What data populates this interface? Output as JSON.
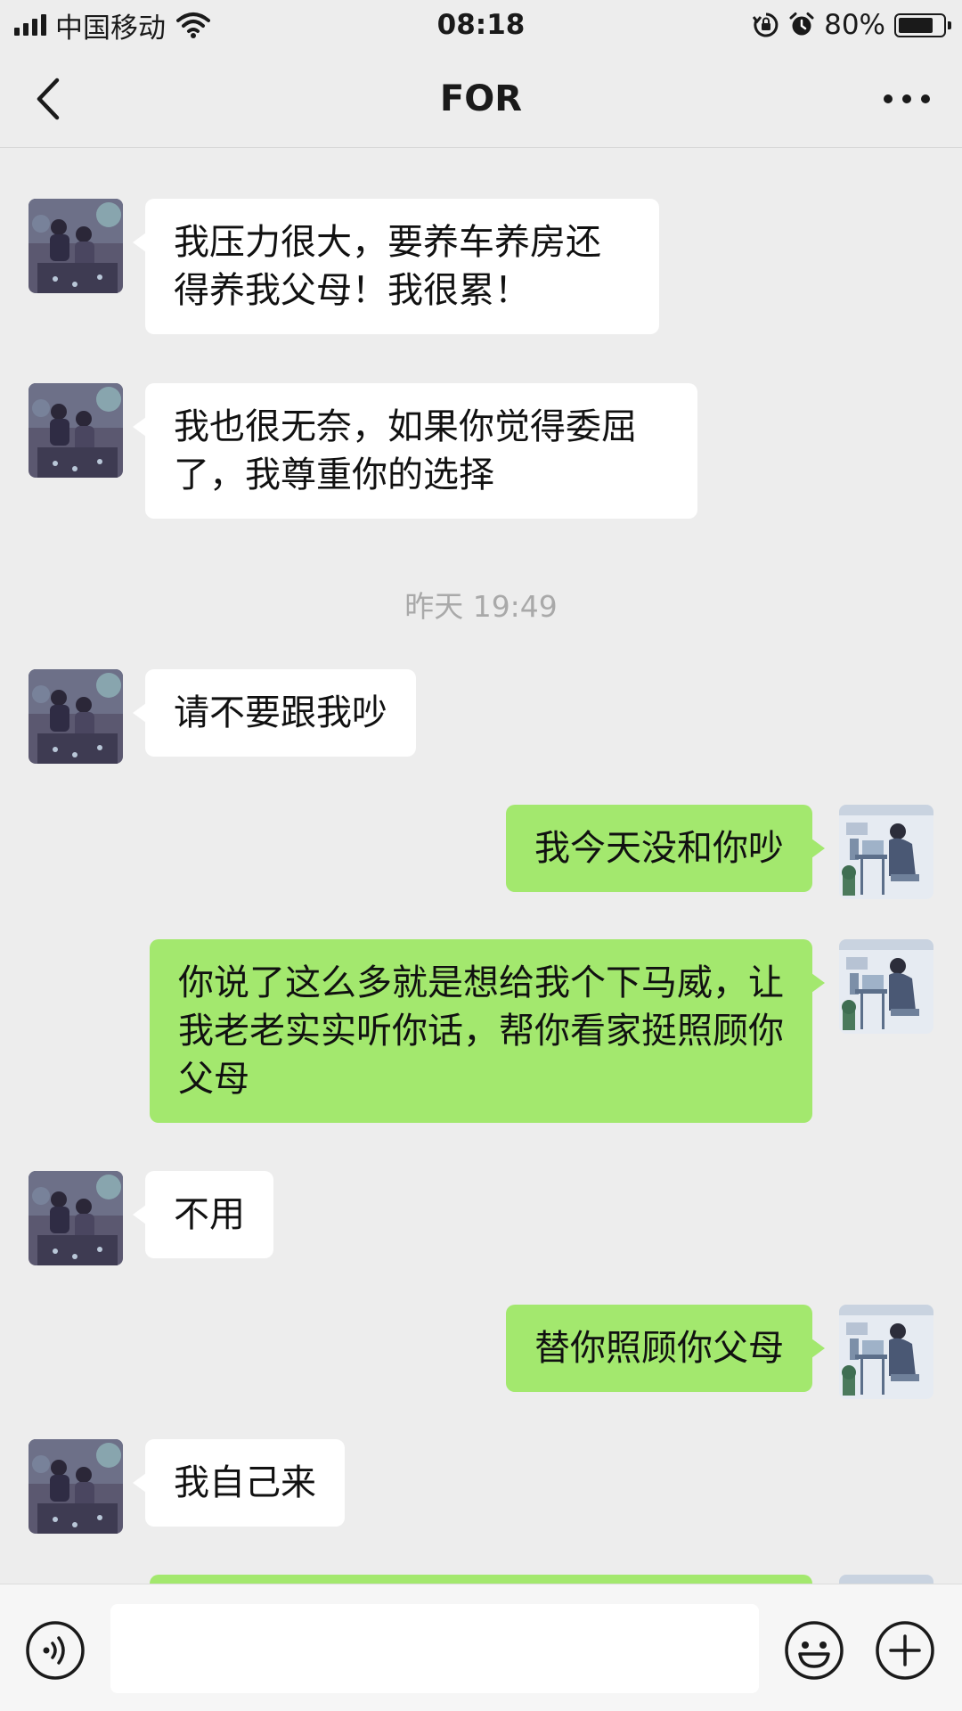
{
  "status_bar": {
    "carrier": "中国移动",
    "time": "08:18",
    "battery_pct": "80%",
    "battery_level": 0.8
  },
  "nav": {
    "title": "FOR",
    "back_icon": "chevron-left-icon",
    "more_icon": "more-dots-icon"
  },
  "chat": {
    "messages": [
      {
        "side": "in",
        "text": "我压力很大，要养车养房还得养我父母！我很累！"
      },
      {
        "side": "in",
        "text": "我也很无奈，如果你觉得委屈了，我尊重你的选择"
      },
      {
        "type": "timestamp",
        "text": "昨天 19:49"
      },
      {
        "side": "in",
        "text": "请不要跟我吵"
      },
      {
        "side": "out",
        "text": "我今天没和你吵"
      },
      {
        "side": "out",
        "text": "你说了这么多就是想给我个下马威，让我老老实实听你话，帮你看家挺照顾你父母"
      },
      {
        "side": "in",
        "text": "不用"
      },
      {
        "side": "out",
        "text": "替你照顾你父母"
      },
      {
        "side": "in",
        "text": "我自己来"
      }
    ]
  },
  "input_bar": {
    "voice_icon": "voice-icon",
    "emoji_icon": "emoji-icon",
    "plus_icon": "plus-icon",
    "input_value": ""
  },
  "colors": {
    "background": "#ededed",
    "bubble_out": "#a3e86e",
    "bubble_in": "#ffffff",
    "timestamp": "#a9a9a9"
  }
}
